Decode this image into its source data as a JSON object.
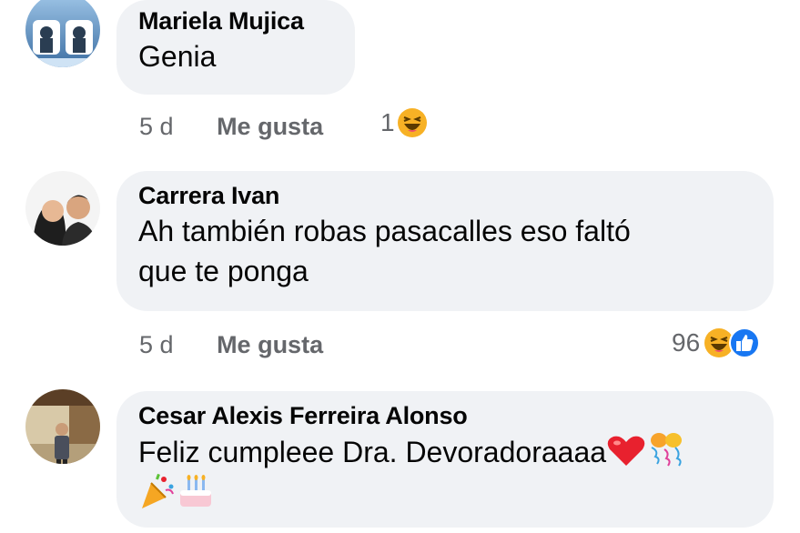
{
  "comments": [
    {
      "author": "Mariela Mujica",
      "text": "Genia",
      "time": "5 d",
      "like_label": "Me gusta",
      "reaction_count": "1",
      "reactions": [
        "haha-icon"
      ]
    },
    {
      "author": "Carrera Ivan",
      "text_line1": "Ah también robas pasacalles eso faltó",
      "text_line2": "que te ponga",
      "time": "5 d",
      "like_label": "Me gusta",
      "reaction_count": "96",
      "reactions": [
        "haha-icon",
        "like-icon"
      ]
    },
    {
      "author": "Cesar Alexis Ferreira Alonso",
      "text": "Feliz cumpleee Dra. Devoradoraaaa",
      "emojis": [
        "red-heart-emoji",
        "balloon-emoji",
        "party-popper-emoji",
        "birthday-cake-emoji"
      ]
    }
  ],
  "colors": {
    "bubble_bg": "#f0f2f5",
    "text": "#050505",
    "secondary": "#65676b",
    "like_blue": "#1877f2",
    "haha_yellow": "#f7b125"
  }
}
